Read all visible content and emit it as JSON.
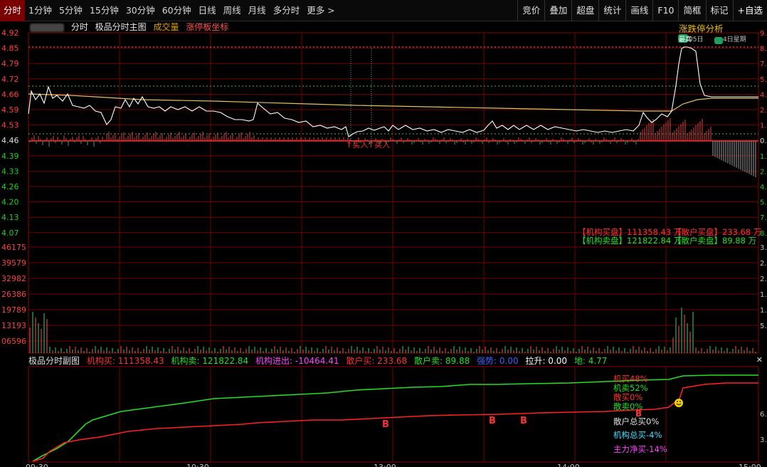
{
  "toolbar": {
    "periods": [
      "分时",
      "1分钟",
      "5分钟",
      "15分钟",
      "30分钟",
      "60分钟",
      "日线",
      "周线",
      "月线",
      "多分时",
      "更多 >"
    ],
    "active_index": 0,
    "right_buttons": [
      "竞价",
      "叠加",
      "超盘",
      "统计",
      "画线",
      "F10",
      "简框",
      "标记",
      "+自选"
    ]
  },
  "info_bar": {
    "t1": "分时",
    "t2": "极品分时主图",
    "t3": "成交量",
    "t4": "涨停板坐标"
  },
  "zt_button": "涨跌停分析",
  "price_axis": [
    "4.92",
    "4.85",
    "4.79",
    "4.72",
    "4.66",
    "4.59",
    "4.53",
    "4.46",
    "4.39",
    "4.33",
    "4.26",
    "4.20",
    "4.13",
    "4.07"
  ],
  "price_axis_right": [
    "9.",
    "8.",
    "7.",
    "5.",
    "4.",
    "2.",
    "1.",
    "0.",
    "1.",
    "2.",
    "4.",
    "5.",
    "7.",
    "8."
  ],
  "volume_axis": [
    "46175",
    "39579",
    "32982",
    "26386",
    "19789",
    "13193",
    "06596"
  ],
  "volume_axis_right": [
    "3.",
    "2.",
    "2.",
    "1.",
    "1.",
    "5.",
    ""
  ],
  "time_axis": [
    "09:30",
    "10:30",
    "13:00",
    "14:00",
    "15:00"
  ],
  "markers": {
    "buy1": "↑买入",
    "buy2": "↑买入",
    "top1": "最高",
    "top2": "05日",
    "top3": "4日星期"
  },
  "panel_labels": {
    "jg_buy": "【机构买盘】111358.43 万",
    "sh_buy": "【散户买盘】233.68 万",
    "jg_sell": "【机构卖盘】121822.84 万",
    "sh_sell": "【散户卖盘】89.88 万"
  },
  "sub_header": {
    "title": "极品分时副图",
    "jg_buy": "机构买: 111358.43",
    "jg_sell": "机构卖: 121822.84",
    "jg_net": "机构进出: -10464.41",
    "sh_buy": "散户买: 233.68",
    "sh_sell": "散户卖: 89.88",
    "strong": "强势: 0.00",
    "up": "拉升: 0.00",
    "di": "地: 4.77"
  },
  "sub_legend": {
    "a": "机买48%",
    "b": "机卖52%",
    "c": "散买0%",
    "d": "散卖0%",
    "e": "散户总买0%",
    "f": "机构总买-4%",
    "g": "主力净买-14%"
  },
  "sub_right_axis": [
    "6.",
    "3."
  ],
  "b_marks": [
    "B",
    "B",
    "B",
    "B"
  ],
  "colors": {
    "red": "#ff3030",
    "green": "#20e020",
    "white": "#ffffff",
    "yellow": "#f0c000",
    "magenta": "#ff40ff",
    "cyan": "#40e0ff",
    "grid": "#800000"
  }
}
